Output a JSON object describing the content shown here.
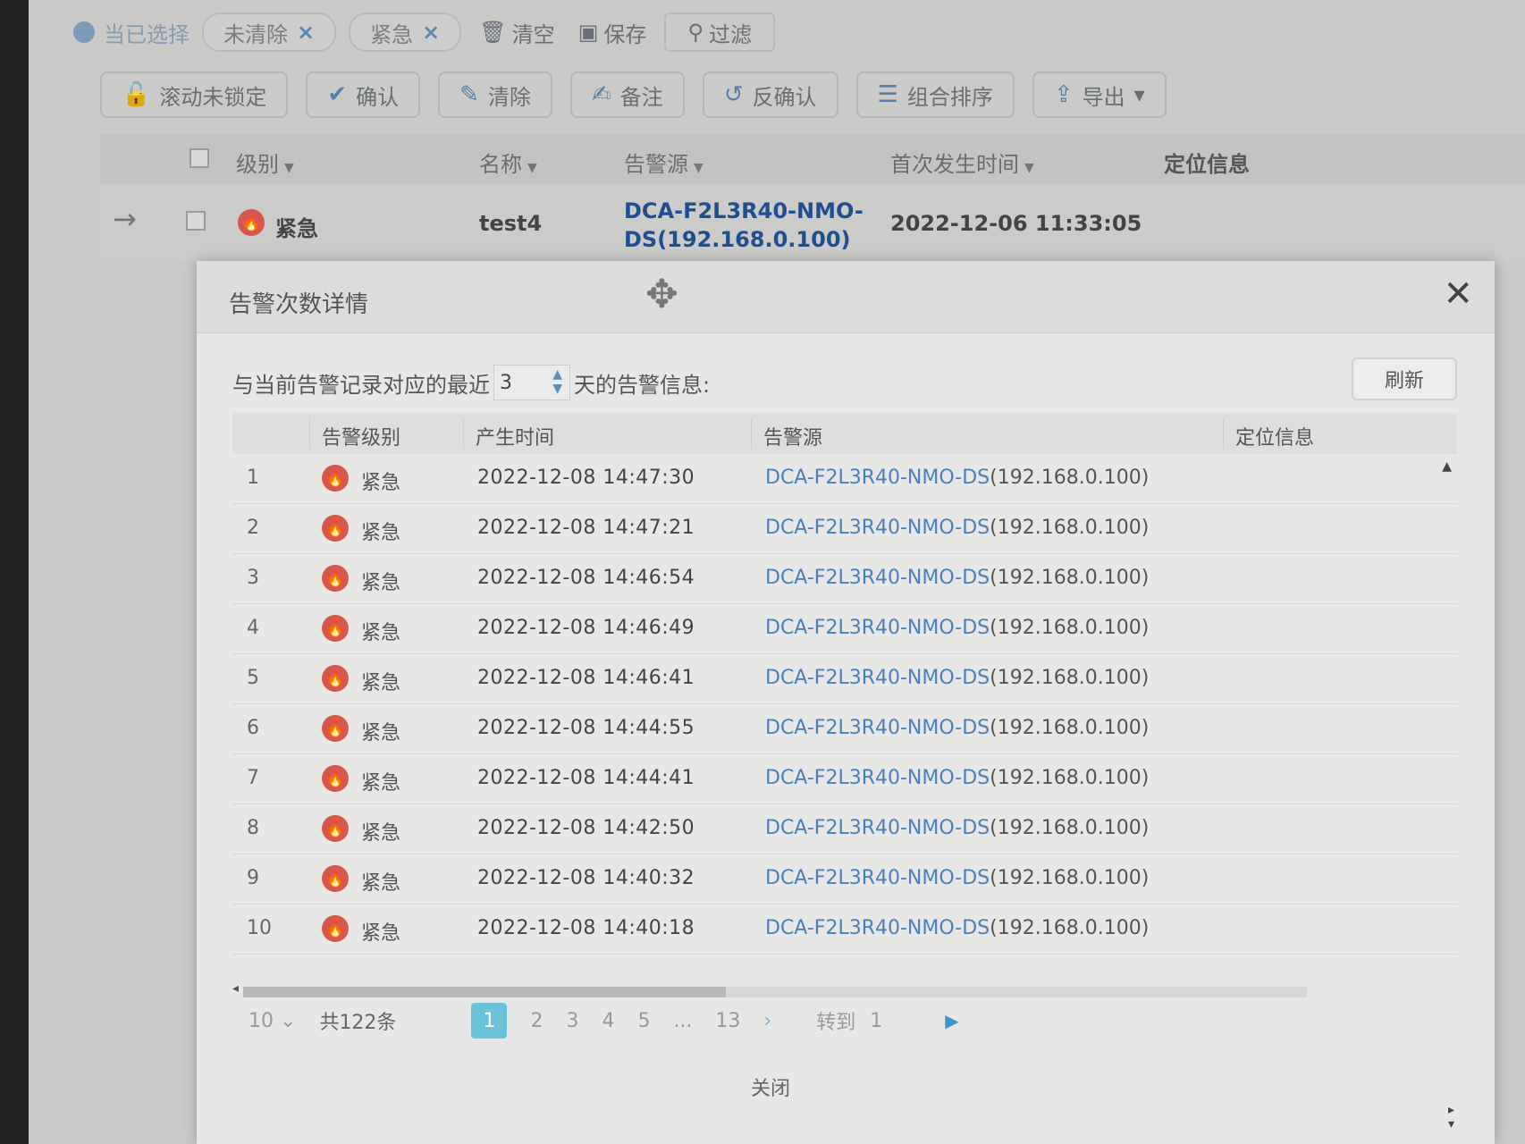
{
  "filter_bar": {
    "selected_label": "当已选择",
    "chips": [
      {
        "label": "未清除",
        "close": "×"
      },
      {
        "label": "紧急",
        "close": "×"
      }
    ],
    "clear_label": "清空",
    "save_label": "保存",
    "filter_label": "过滤"
  },
  "toolbar": {
    "scroll_lock": "滚动未锁定",
    "confirm": "确认",
    "clear": "清除",
    "note": "备注",
    "unconfirm": "反确认",
    "sort": "组合排序",
    "export": "导出"
  },
  "list_header": {
    "level": "级别",
    "name": "名称",
    "source": "告警源",
    "first_time": "首次发生时间",
    "location": "定位信息"
  },
  "alarm_row": {
    "level": "紧急",
    "name": "test4",
    "source_line1": "DCA-F2L3R40-NMO-",
    "source_line2": "DS(192.168.0.100)",
    "first_time": "2022-12-06 11:33:05"
  },
  "dialog": {
    "title": "告警次数详情",
    "days_prefix": "与当前告警记录对应的最近",
    "days_value": "3",
    "days_suffix": "天的告警信息:",
    "refresh": "刷新",
    "columns": {
      "level": "告警级别",
      "time": "产生时间",
      "source": "告警源",
      "location": "定位信息"
    },
    "rows": [
      {
        "idx": "1",
        "level": "紧急",
        "time": "2022-12-08 14:47:30",
        "src_name": "DCA-F2L3R40-NMO-DS",
        "src_ip": "(192.168.0.100)"
      },
      {
        "idx": "2",
        "level": "紧急",
        "time": "2022-12-08 14:47:21",
        "src_name": "DCA-F2L3R40-NMO-DS",
        "src_ip": "(192.168.0.100)"
      },
      {
        "idx": "3",
        "level": "紧急",
        "time": "2022-12-08 14:46:54",
        "src_name": "DCA-F2L3R40-NMO-DS",
        "src_ip": "(192.168.0.100)"
      },
      {
        "idx": "4",
        "level": "紧急",
        "time": "2022-12-08 14:46:49",
        "src_name": "DCA-F2L3R40-NMO-DS",
        "src_ip": "(192.168.0.100)"
      },
      {
        "idx": "5",
        "level": "紧急",
        "time": "2022-12-08 14:46:41",
        "src_name": "DCA-F2L3R40-NMO-DS",
        "src_ip": "(192.168.0.100)"
      },
      {
        "idx": "6",
        "level": "紧急",
        "time": "2022-12-08 14:44:55",
        "src_name": "DCA-F2L3R40-NMO-DS",
        "src_ip": "(192.168.0.100)"
      },
      {
        "idx": "7",
        "level": "紧急",
        "time": "2022-12-08 14:44:41",
        "src_name": "DCA-F2L3R40-NMO-DS",
        "src_ip": "(192.168.0.100)"
      },
      {
        "idx": "8",
        "level": "紧急",
        "time": "2022-12-08 14:42:50",
        "src_name": "DCA-F2L3R40-NMO-DS",
        "src_ip": "(192.168.0.100)"
      },
      {
        "idx": "9",
        "level": "紧急",
        "time": "2022-12-08 14:40:32",
        "src_name": "DCA-F2L3R40-NMO-DS",
        "src_ip": "(192.168.0.100)"
      },
      {
        "idx": "10",
        "level": "紧急",
        "time": "2022-12-08 14:40:18",
        "src_name": "DCA-F2L3R40-NMO-DS",
        "src_ip": "(192.168.0.100)"
      }
    ],
    "pager": {
      "page_size": "10",
      "total": "共122条",
      "pages": [
        "1",
        "2",
        "3",
        "4",
        "5",
        "...",
        "13"
      ],
      "current": "1",
      "goto_label": "转到",
      "goto_value": "1"
    },
    "close": "关闭"
  },
  "colors": {
    "critical": "#d7584a",
    "link": "#4a7fbf",
    "pager_active": "#6cc3d9"
  },
  "icons": [
    "selection-dot-icon",
    "trash-icon",
    "save-icon",
    "search-icon",
    "unlock-icon",
    "check-circle-icon",
    "eraser-icon",
    "note-icon",
    "undo-icon",
    "sort-icon",
    "export-icon",
    "arrow-right-icon",
    "critical-alarm-icon",
    "move-icon",
    "close-icon",
    "spinner-arrows-icon"
  ]
}
